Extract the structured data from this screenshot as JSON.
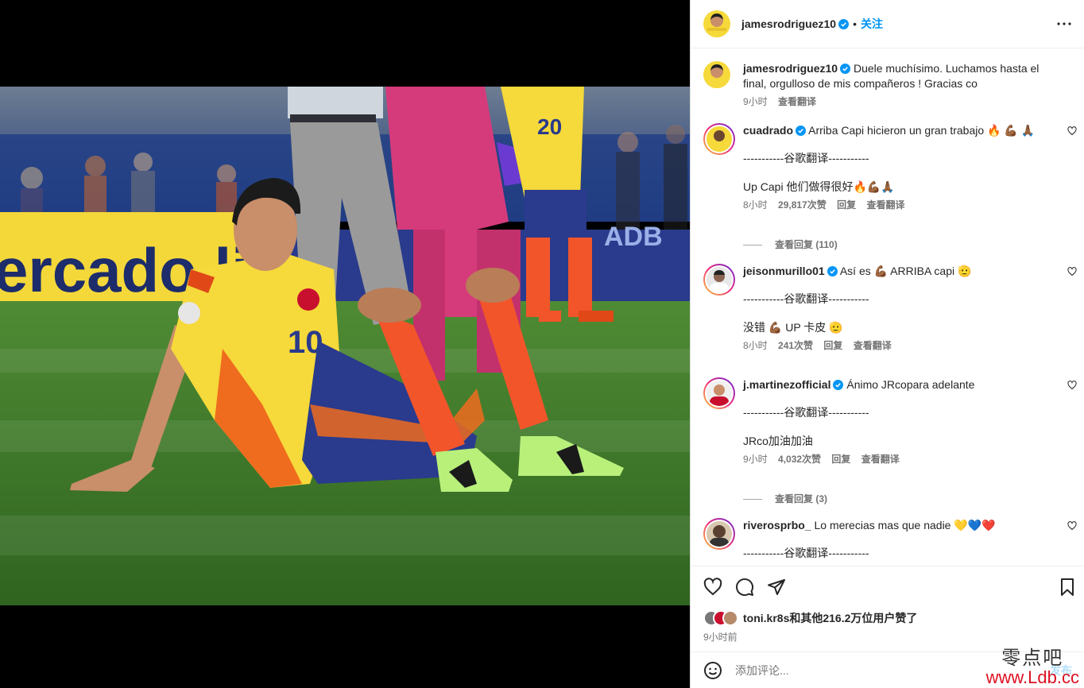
{
  "post": {
    "author": "jamesrodriguez10",
    "follow_label": "关注",
    "caption": "Duele muchísimo. Luchamos hasta el final, orgulloso de mis compañeros ! Gracias co",
    "caption_time": "9小时",
    "caption_translate": "查看翻译"
  },
  "comments": [
    {
      "user": "cuadrado",
      "text": "Arriba Capi hicieron un gran trabajo 🔥 💪🏾 🙏🏾",
      "divider": "-----------谷歌翻译-----------",
      "translation": "Up Capi 他们做得很好🔥💪🏾🙏🏾",
      "time": "8小时",
      "likes": "29,817次赞",
      "reply": "回复",
      "translate": "查看翻译",
      "view_replies": "查看回复 (110)"
    },
    {
      "user": "jeisonmurillo01",
      "text": "Así es 💪🏾 ARRIBA capi 🫡",
      "divider": "-----------谷歌翻译-----------",
      "translation": "没错 💪🏾 UP 卡皮 🫡",
      "time": "8小时",
      "likes": "241次赞",
      "reply": "回复",
      "translate": "查看翻译"
    },
    {
      "user": "j.martinezofficial",
      "text": "Ánimo JRcopara adelante",
      "divider": "-----------谷歌翻译-----------",
      "translation": "JRco加油加油",
      "time": "9小时",
      "likes": "4,032次赞",
      "reply": "回复",
      "translate": "查看翻译",
      "view_replies": "查看回复 (3)"
    },
    {
      "user": "riverosprbo_",
      "text": "Lo merecias mas que nadie 💛💙❤️",
      "divider": "-----------谷歌翻译-----------"
    }
  ],
  "likes_summary": "toni.kr8s和其他216.2万位用户赞了",
  "post_time": "9小时前",
  "compose": {
    "placeholder": "添加评论...",
    "post_label": "发布"
  },
  "watermark": {
    "line1": "零点吧",
    "line2": "www.Ldb.cc"
  },
  "photo": {
    "jersey_number": "10",
    "background_jersey_number": "20",
    "sponsor_text": "ercado libre",
    "board_text": "ADB"
  },
  "colors": {
    "accent": "#0095f6",
    "verified": "#0095f6",
    "jersey_yellow": "#f6d93a",
    "socks_orange": "#f2552a",
    "pitch_green": "#3c7a2a"
  },
  "icons": [
    "more-icon",
    "verified-icon",
    "heart-icon",
    "comment-icon",
    "share-icon",
    "bookmark-icon",
    "emoji-icon"
  ]
}
